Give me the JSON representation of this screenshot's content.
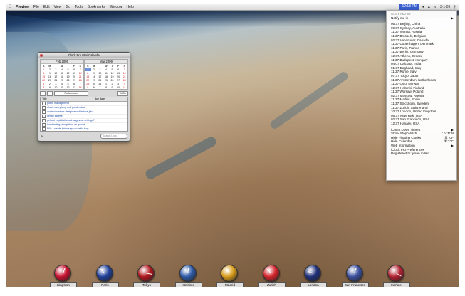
{
  "menubar": {
    "app_name": "Preview",
    "items": [
      "File",
      "Edit",
      "View",
      "Go",
      "Tools",
      "Bookmarks",
      "Window",
      "Help"
    ],
    "clock_label": "12:18 PM",
    "status_date": "3-1-09"
  },
  "dropdown": {
    "date": "Sun 1 Mar 09",
    "notify": "Notify me in",
    "cities": [
      {
        "time": "05:37",
        "city": "Beijing, China"
      },
      {
        "time": "09:37",
        "city": "Sydney, Australia"
      },
      {
        "time": "11:37",
        "city": "Vienna, Austria"
      },
      {
        "time": "11:37",
        "city": "Brussels, Belgium"
      },
      {
        "time": "02:37",
        "city": "Vancouver, Canada"
      },
      {
        "time": "11:37",
        "city": "Copenhagen, Denmark"
      },
      {
        "time": "11:37",
        "city": "Paris, France"
      },
      {
        "time": "11:37",
        "city": "Berlin, Germany"
      },
      {
        "time": "12:37",
        "city": "Athens, Greece"
      },
      {
        "time": "11:37",
        "city": "Budapest, Hungary"
      },
      {
        "time": "04:07",
        "city": "Calcutta, India"
      },
      {
        "time": "01:37",
        "city": "Baghdad, Iraq"
      },
      {
        "time": "11:37",
        "city": "Rome, Italy"
      },
      {
        "time": "07:37",
        "city": "Tokyo, Japan"
      },
      {
        "time": "11:37",
        "city": "Amsterdam, Netherlands"
      },
      {
        "time": "11:37",
        "city": "Oslo, Norway"
      },
      {
        "time": "12:37",
        "city": "Helsinki, Finland"
      },
      {
        "time": "11:37",
        "city": "Warsaw, Poland"
      },
      {
        "time": "02:37",
        "city": "Moscow, Russia"
      },
      {
        "time": "11:37",
        "city": "Madrid, Spain"
      },
      {
        "time": "11:37",
        "city": "Stockholm, Sweden"
      },
      {
        "time": "11:37",
        "city": "Zurich, Switzerland"
      },
      {
        "time": "10:37",
        "city": "London, United Kingdom"
      },
      {
        "time": "05:37",
        "city": "New York, USA"
      },
      {
        "time": "02:37",
        "city": "San Francisco, USA"
      },
      {
        "time": "12:37",
        "city": "Hanalei, USA"
      }
    ],
    "actions": [
      {
        "label": "iCount Down Timers",
        "shortcut": "",
        "sub": true
      },
      {
        "label": "Show Stop Watch",
        "shortcut": "⌃⌥⌘W",
        "sub": false
      },
      {
        "label": "Hide Floating Clocks",
        "shortcut": "⌘⌥F",
        "sub": false
      },
      {
        "label": "Hide Calendar",
        "shortcut": "⌘⌥C",
        "sub": false
      },
      {
        "label": "Web Information",
        "shortcut": "",
        "sub": true
      },
      {
        "label": "iClock Pro Preferences",
        "shortcut": "",
        "sub": false
      },
      {
        "label": "Registered to: julian miller",
        "shortcut": "",
        "sub": false
      }
    ]
  },
  "calendar": {
    "title": "iClock Pro Mini Calendar",
    "weekdays": [
      "S",
      "M",
      "T",
      "W",
      "T",
      "F",
      "S"
    ],
    "months": [
      {
        "name": "Feb 2009",
        "weeks": [
          [
            "1",
            "2",
            "3",
            "4",
            "5",
            "6",
            "7"
          ],
          [
            "8",
            "9",
            "10",
            "11",
            "12",
            "13",
            "14"
          ],
          [
            "15",
            "16",
            "17",
            "18",
            "19",
            "20",
            "21"
          ],
          [
            "22",
            "23",
            "24",
            "25",
            "26",
            "27",
            "28"
          ],
          [
            "1",
            "2",
            "3",
            "4",
            "5",
            "6",
            "7"
          ],
          [
            "8",
            "9",
            "10",
            "11",
            "12",
            "13",
            "14"
          ]
        ]
      },
      {
        "name": "Mar 2009",
        "weeks": [
          [
            "1",
            "2",
            "3",
            "4",
            "5",
            "6",
            "7"
          ],
          [
            "8",
            "9",
            "10",
            "11",
            "12",
            "13",
            "14"
          ],
          [
            "15",
            "16",
            "17",
            "18",
            "19",
            "20",
            "21"
          ],
          [
            "22",
            "23",
            "24",
            "25",
            "26",
            "27",
            "28"
          ],
          [
            "29",
            "30",
            "31",
            "1",
            "2",
            "3",
            "4"
          ],
          [
            "5",
            "6",
            "7",
            "8",
            "9",
            "10",
            "11"
          ]
        ]
      }
    ],
    "toolbar": {
      "add": "+",
      "remove": "−",
      "preferences": "Preferences",
      "todo": "To Do"
    },
    "list_headers": {
      "title": "Title",
      "due": "due date"
    },
    "todos": [
      "poem management",
      "check everything and ponder deal",
      "contact contour design about lettuce job",
      "dental palette",
      "get old exploitations changes on settings?",
      "handwriting recognition on iphone",
      "Bills - create iphone app to build frog"
    ],
    "search_placeholder": "Search Lists"
  },
  "dock": {
    "clocks": [
      {
        "city": "Kingston",
        "color": "#c8102e",
        "angle": 20
      },
      {
        "city": "Paris",
        "color": "#1f3f9a",
        "angle": 320
      },
      {
        "city": "Tokyo",
        "color": "#b0161c",
        "angle": 100
      },
      {
        "city": "Helsinki",
        "color": "#2e5aa8",
        "angle": 10
      },
      {
        "city": "Madrid",
        "color": "#d89b1a",
        "angle": 320
      },
      {
        "city": "Zurich",
        "color": "#d3232a",
        "angle": 320
      },
      {
        "city": "London",
        "color": "#1e2f7a",
        "angle": 290
      },
      {
        "city": "San Francisco",
        "color": "#3b4f9e",
        "angle": 20
      },
      {
        "city": "Hanalei",
        "color": "#b1202f",
        "angle": 120
      }
    ]
  }
}
